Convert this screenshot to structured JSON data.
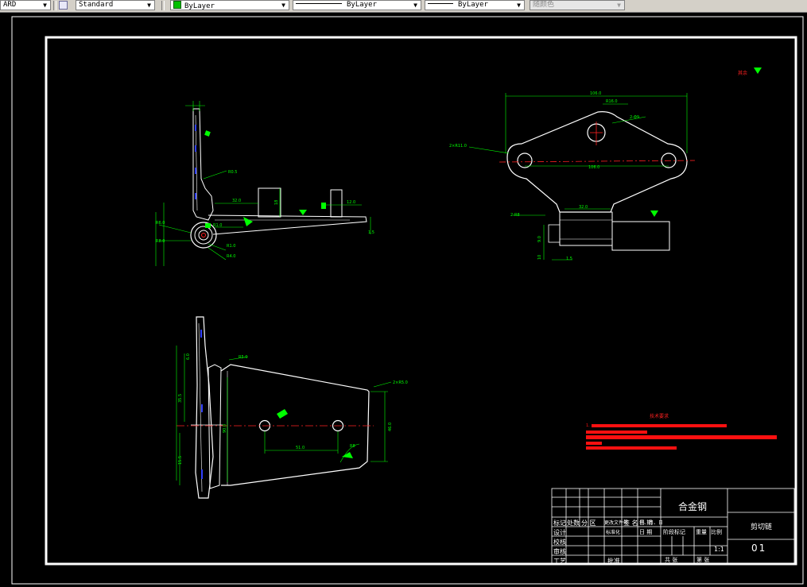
{
  "toolbar": {
    "linetype_scale_value": "ARD",
    "text_style_value": "Standard",
    "layer_color_value": "ByLayer",
    "linetype_value": "ByLayer",
    "lineweight_value": "ByLayer",
    "plot_style_value": "随颜色"
  },
  "drawing": {
    "roughness_note": "其余",
    "tech_requirements_heading": "技术要求",
    "title_block": {
      "material": "合金钢",
      "part_name": "剪切链",
      "drawing_number": "01",
      "scale": "1:1",
      "header_row": [
        "标记",
        "处数",
        "分 区",
        "更改文件号",
        "签 名",
        "年、月、日"
      ],
      "row_design": "设计",
      "row_standardize": "标准化",
      "row_check": "校核",
      "row_review": "审核",
      "row_process": "工艺",
      "row_approve": "批准",
      "stage_mark": "阶段标记",
      "weight": "重量",
      "scale_label": "比例",
      "sheets_total": "共  张",
      "sheet_no": "第  张",
      "date_label_1": "日 期",
      "date_label_2": "日 期"
    }
  },
  "colors": {
    "background": "#000000",
    "geometry": "#ffffff",
    "dimensions": "#00ff00",
    "centerline": "#ff0000",
    "hidden_blue": "#0000ff",
    "requirements_text": "#ff0000"
  }
}
